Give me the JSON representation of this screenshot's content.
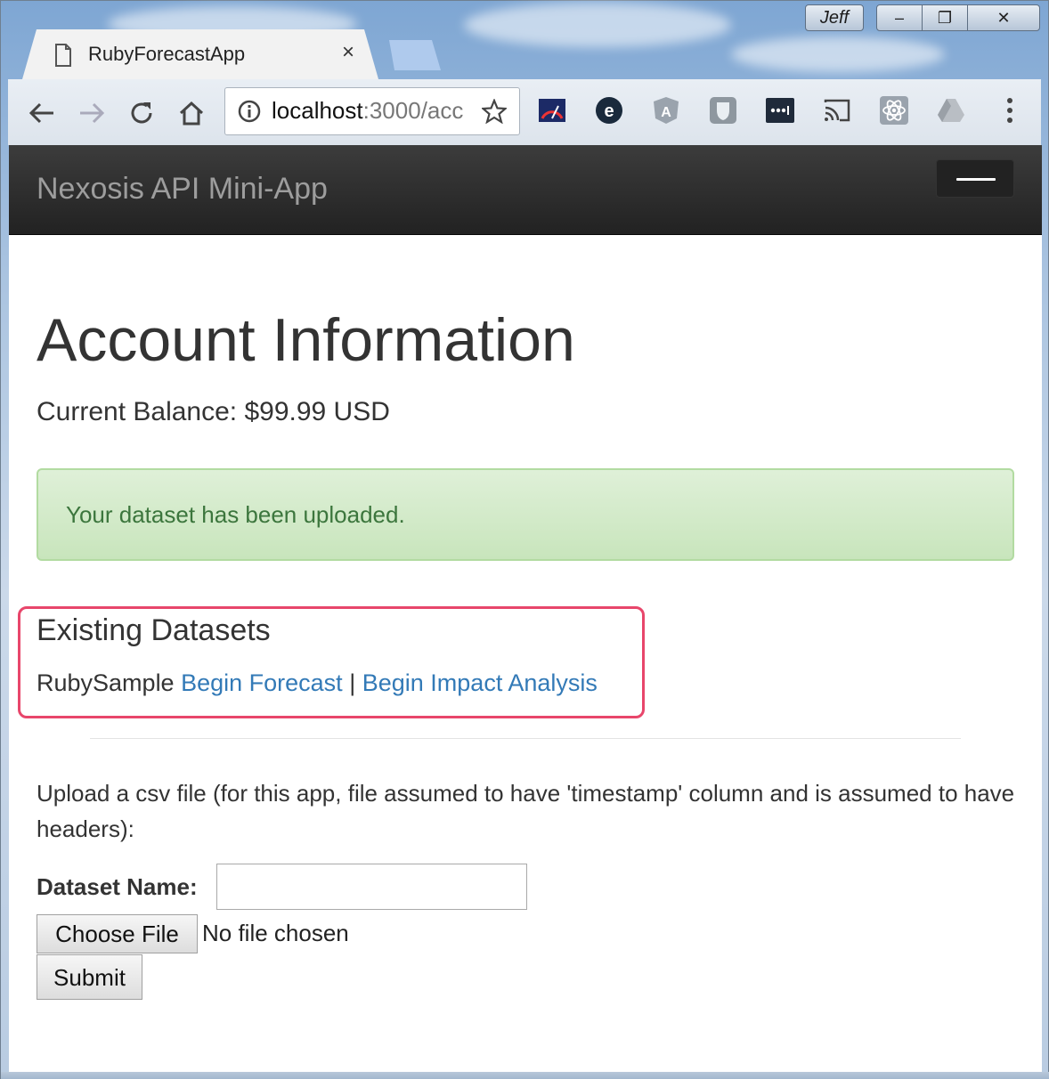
{
  "window": {
    "user": "Jeff",
    "minimize_glyph": "–",
    "maximize_glyph": "❐",
    "close_glyph": "✕"
  },
  "tab": {
    "title": "RubyForecastApp",
    "close_glyph": "×"
  },
  "omnibox": {
    "host": "localhost",
    "rest": ":3000/acc"
  },
  "extensions": [
    "speedometer-icon",
    "ie-tab-icon",
    "angular-icon",
    "shield-icon",
    "lastpass-icon",
    "cast-icon",
    "react-icon",
    "drive-icon"
  ],
  "app": {
    "brand": "Nexosis API Mini-App",
    "heading": "Account Information",
    "balance": "Current Balance: $99.99 USD",
    "alert": "Your dataset has been uploaded.",
    "datasets_heading": "Existing Datasets",
    "datasets": [
      {
        "name": "RubySample",
        "forecast_link": "Begin Forecast",
        "separator": "|",
        "impact_link": "Begin Impact Analysis"
      }
    ],
    "upload_instructions": "Upload a csv file (for this app, file assumed to have 'timestamp' column and is assumed to have headers):",
    "dataset_name_label": "Dataset Name:",
    "dataset_name_value": "",
    "choose_file_label": "Choose File",
    "file_status": "No file chosen",
    "submit_label": "Submit"
  },
  "colors": {
    "highlight": "#e8466b",
    "link": "#337ab7",
    "alert_text": "#3c763d"
  }
}
